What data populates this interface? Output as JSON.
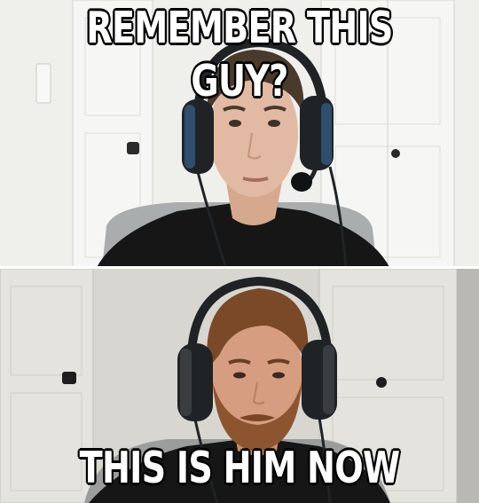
{
  "captions": {
    "top": "REMEMBER THIS GUY?",
    "bottom": "THIS IS HIM NOW"
  },
  "colors": {
    "caption_text": "#ffffff",
    "caption_outline": "#000000",
    "wall_top": "#efefec",
    "wall_bottom": "#d7d6d1",
    "door_top": "#f8f8f6",
    "door_bottom": "#e4e3de",
    "headset": "#1f2326",
    "shirt": "#161616",
    "hair_top": "#4a3a2c",
    "hair_bottom": "#7a4a28",
    "beard": "#8c5530"
  },
  "icons": [
    "headset-icon",
    "microphone-icon",
    "door-handle-icon"
  ]
}
